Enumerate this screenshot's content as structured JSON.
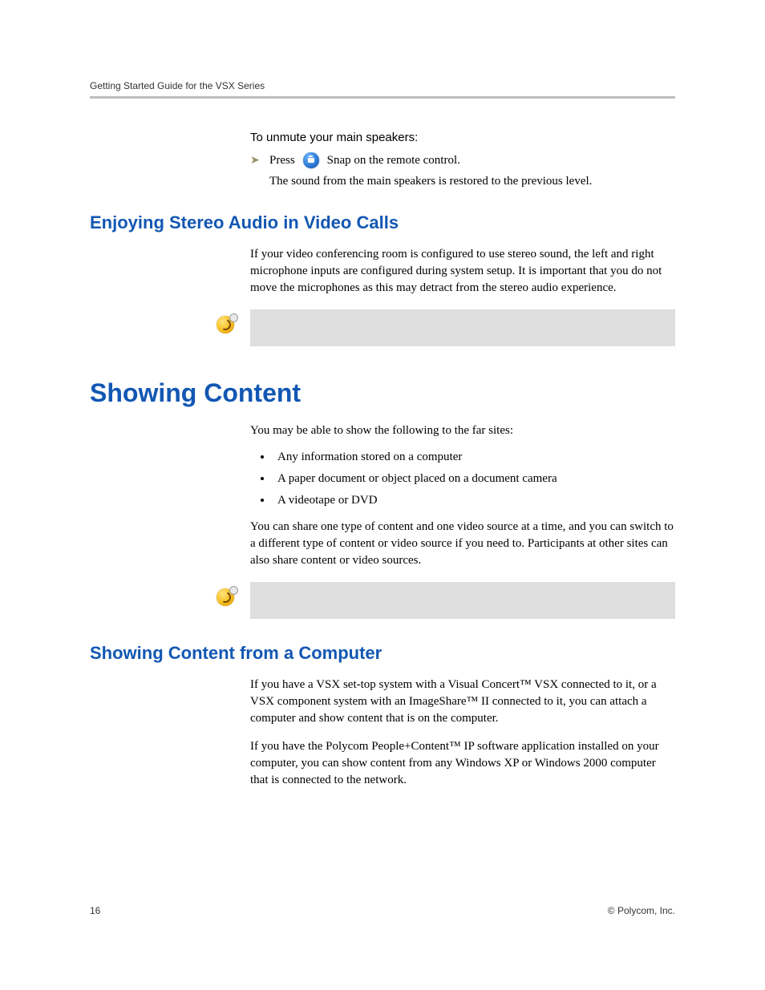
{
  "header": {
    "running_title": "Getting Started Guide for the VSX Series"
  },
  "unmute": {
    "intro": "To unmute your main speakers:",
    "press": "Press",
    "snap_label": "Snap on the remote control.",
    "result": "The sound from the main speakers is restored to the previous level."
  },
  "stereo": {
    "heading": "Enjoying Stereo Audio in Video Calls",
    "body": "If your video conferencing room is configured to use stereo sound, the left and right microphone inputs are configured during system setup. It is important that you do not move the microphones as this may detract from the stereo audio experience."
  },
  "showing": {
    "heading": "Showing Content",
    "intro": "You may be able to show the following to the far sites:",
    "bullets": [
      "Any information stored on a computer",
      "A paper document or object placed on a document camera",
      "A videotape or DVD"
    ],
    "after": "You can share one type of content and one video source at a time, and you can switch to a different type of content or video source if you need to. Participants at other sites can also share content or video sources."
  },
  "from_computer": {
    "heading": "Showing Content from a Computer",
    "p1": "If you have a VSX set-top system with a Visual Concert™ VSX connected to it, or a VSX component system with an ImageShare™ II connected to it, you can attach a computer and show content that is on the computer.",
    "p2": "If you have the Polycom People+Content™ IP software application installed on your computer, you can show content from any Windows XP or Windows 2000 computer that is connected to the network."
  },
  "footer": {
    "page_number": "16",
    "copyright": "© Polycom, Inc."
  }
}
